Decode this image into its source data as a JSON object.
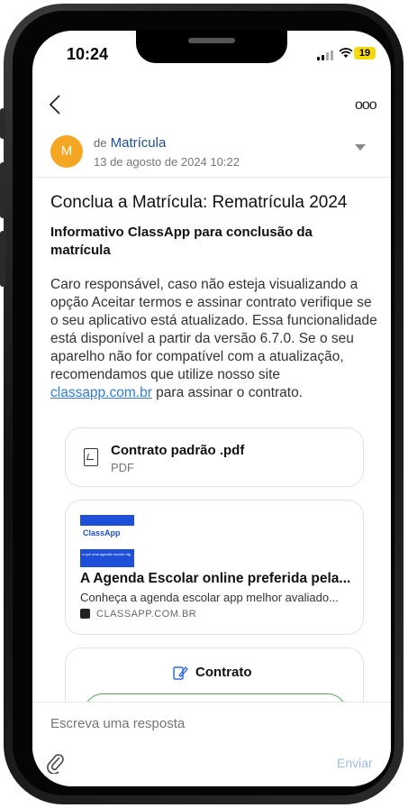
{
  "status": {
    "time": "10:24",
    "battery": "19"
  },
  "nav": {
    "back_icon": "chevron-left-icon",
    "more_icon": "ooo"
  },
  "message": {
    "avatar_letter": "M",
    "from_prefix": "de",
    "from": "Matrícula",
    "date": "13 de agosto de 2024 10:22",
    "title": "Conclua a Matrícula: Rematrícula 2024",
    "subtitle": "Informativo ClassApp para conclusão da matrícula",
    "body": "Caro responsável, caso não esteja visualizando a opção Aceitar termos e assinar contrato verifique se o seu aplicativo está atualizado. Essa funcionalidade está disponível a partir da versão 6.7.0. Se o seu aparelho não for compatível com a atualização, recomendamos que utilize nosso site",
    "body_link": "classapp.com.br",
    "body_end": "para assinar o contrato."
  },
  "attachment": {
    "name": "Contrato padrão .pdf",
    "type": "PDF"
  },
  "link_preview": {
    "thumb_logo": "ClassApp",
    "thumb_tagline": "a que uma agenda escolar dig",
    "title": "A Agenda Escolar online preferida pela...",
    "description": "Conheça a agenda escolar app melhor avaliado...",
    "domain": "CLASSAPP.COM.BR"
  },
  "contract": {
    "label": "Contrato"
  },
  "reply": {
    "placeholder": "Escreva uma resposta",
    "send_label": "Enviar"
  }
}
